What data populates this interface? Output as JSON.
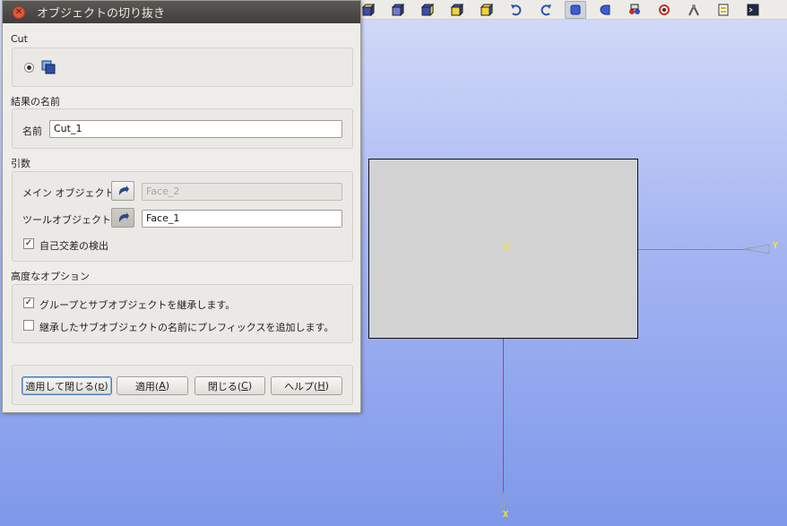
{
  "dialog": {
    "title": "オブジェクトの切り抜き",
    "operation": {
      "section": "Cut"
    },
    "result": {
      "section": "結果の名前",
      "name_label": "名前",
      "name_value": "Cut_1"
    },
    "arguments": {
      "section": "引数",
      "main_label": "メイン オブジェクト",
      "main_value": "Face_2",
      "tool_label": "ツールオブジェクト",
      "tool_value": "Face_1",
      "self_intersection_label": "自己交差の検出",
      "self_intersection_checked": true
    },
    "advanced": {
      "section": "高度なオプション",
      "inherit_label": "グループとサブオブジェクトを継承します。",
      "inherit_checked": true,
      "prefix_label": "継承したサブオブジェクトの名前にプレフィックスを追加します。",
      "prefix_checked": false
    },
    "buttons": {
      "apply_close": "適用して閉じる(",
      "apply_close_key": "p",
      "apply": "適用(",
      "apply_key": "A",
      "close": "閉じる(",
      "close_key": "C",
      "help": "ヘルプ(",
      "help_key": "H",
      "paren": ")"
    }
  },
  "viewport": {
    "axis_labels": {
      "x": "X",
      "y": "Y",
      "z": "Z"
    },
    "colors": {
      "x_axis": "#cc3c45",
      "y_axis": "#27c44a",
      "label": "#f2e531",
      "face": "#d2d2d2"
    }
  },
  "toolbar": {
    "icons": [
      "box-front-icon",
      "box-top-icon",
      "box-left-icon",
      "box-right-icon",
      "box-iso-icon",
      "undo-icon",
      "redo-icon",
      "shading-icon",
      "wireframe-icon",
      "render-icon",
      "rotate-icon",
      "measure-icon",
      "notes-icon",
      "python-console-icon"
    ]
  }
}
